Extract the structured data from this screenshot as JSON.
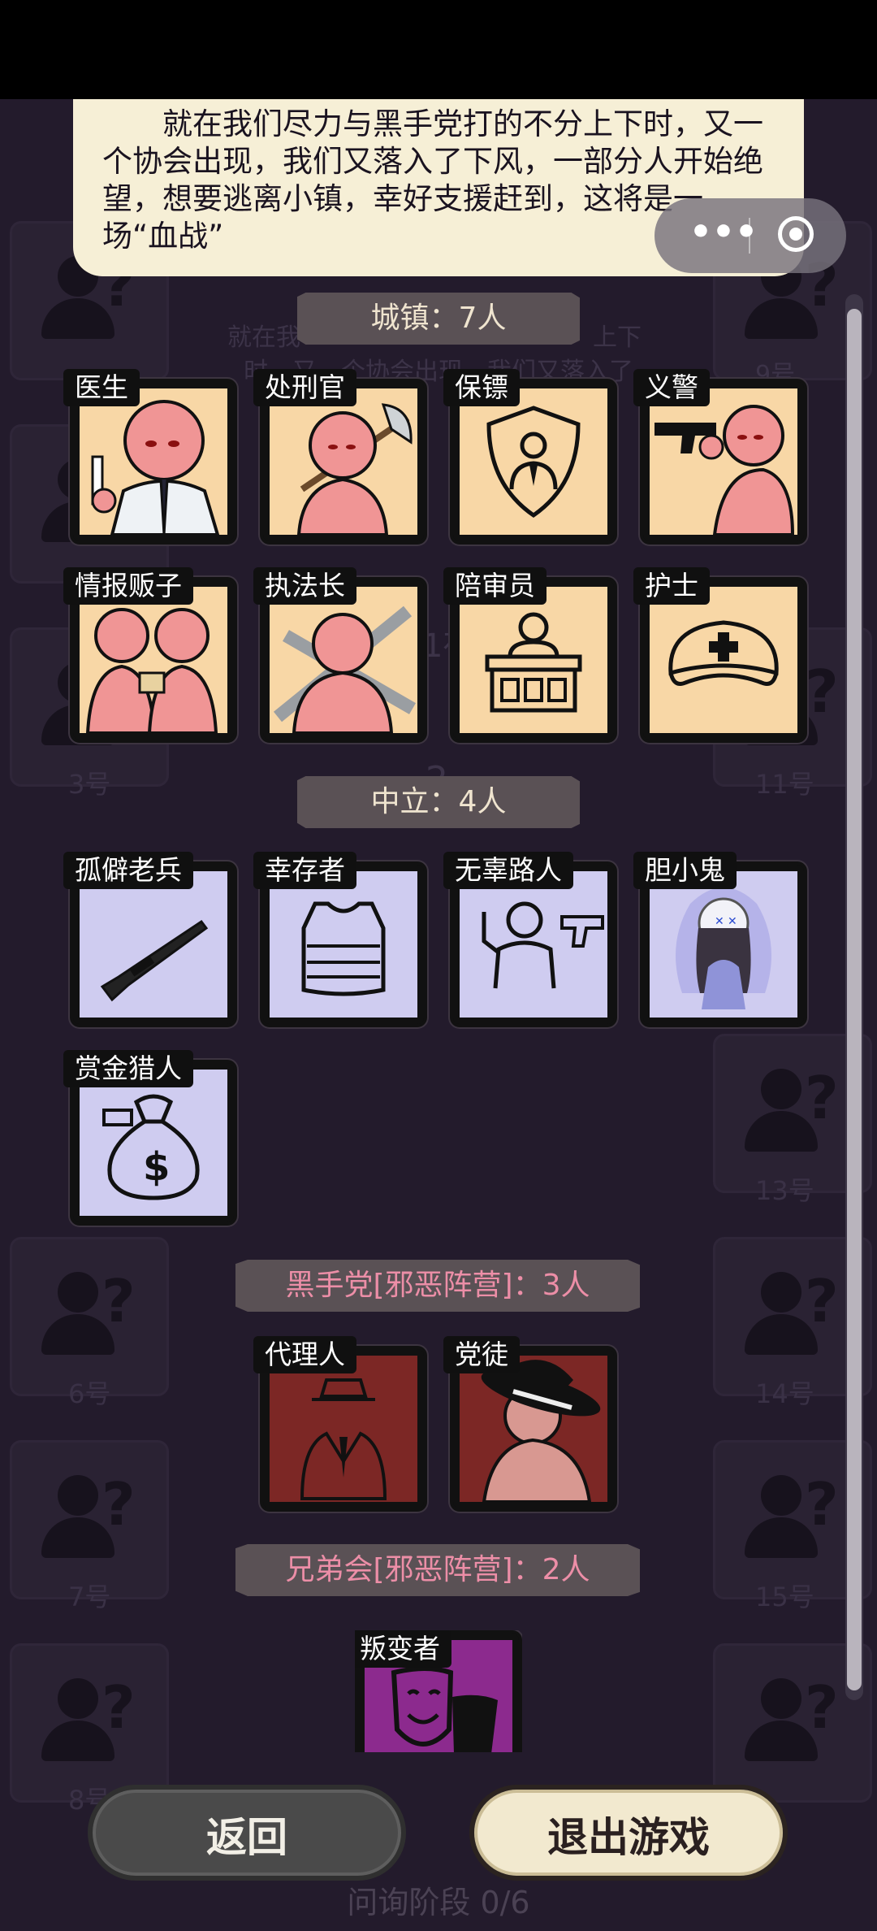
{
  "story_text": "就在我们尽力与黑手党打的不分上下时，又一个协会出现，我们又落入了下风，一部分人开始绝望，想要逃离小镇，幸好支援赶到，这将是一场“血战”",
  "groups": {
    "town": "城镇：7人",
    "neutral": "中立：4人",
    "mafia": "黑手党[邪恶阵营]：3人",
    "brotherhood": "兄弟会[邪恶阵营]：2人"
  },
  "roles": {
    "town": [
      "医生",
      "处刑官",
      "保镖",
      "义警",
      "情报贩子",
      "执法长",
      "陪审员",
      "护士"
    ],
    "neutral": [
      "孤僻老兵",
      "幸存者",
      "无辜路人",
      "胆小鬼",
      "赏金猎人"
    ],
    "mafia": [
      "代理人",
      "党徒"
    ],
    "brotherhood": [
      "叛变者"
    ]
  },
  "buttons": {
    "back": "返回",
    "exit": "退出游戏"
  },
  "phase_text": "问询阶段 0/6",
  "background_seats": [
    "3号",
    "11号",
    "13号",
    "6号",
    "14号",
    "7号",
    "15号",
    "8号"
  ],
  "background_fragments": {
    "line1": "就在我",
    "line1b": "上下",
    "line2": "时，又一个协会出现，我们又落入了",
    "day": "第1夜",
    "num9": "9号",
    "num2": "2"
  },
  "capsule": {
    "more_icon": "more-dots-icon",
    "close_icon": "target-circle-icon"
  },
  "colors": {
    "town_card": "#f8d7a6",
    "neutral_card": "#cfccf0",
    "mafia_card": "#7c2725",
    "brotherhood_card": "#8c2a8e",
    "evil_header_text": "#ec8ea7"
  }
}
